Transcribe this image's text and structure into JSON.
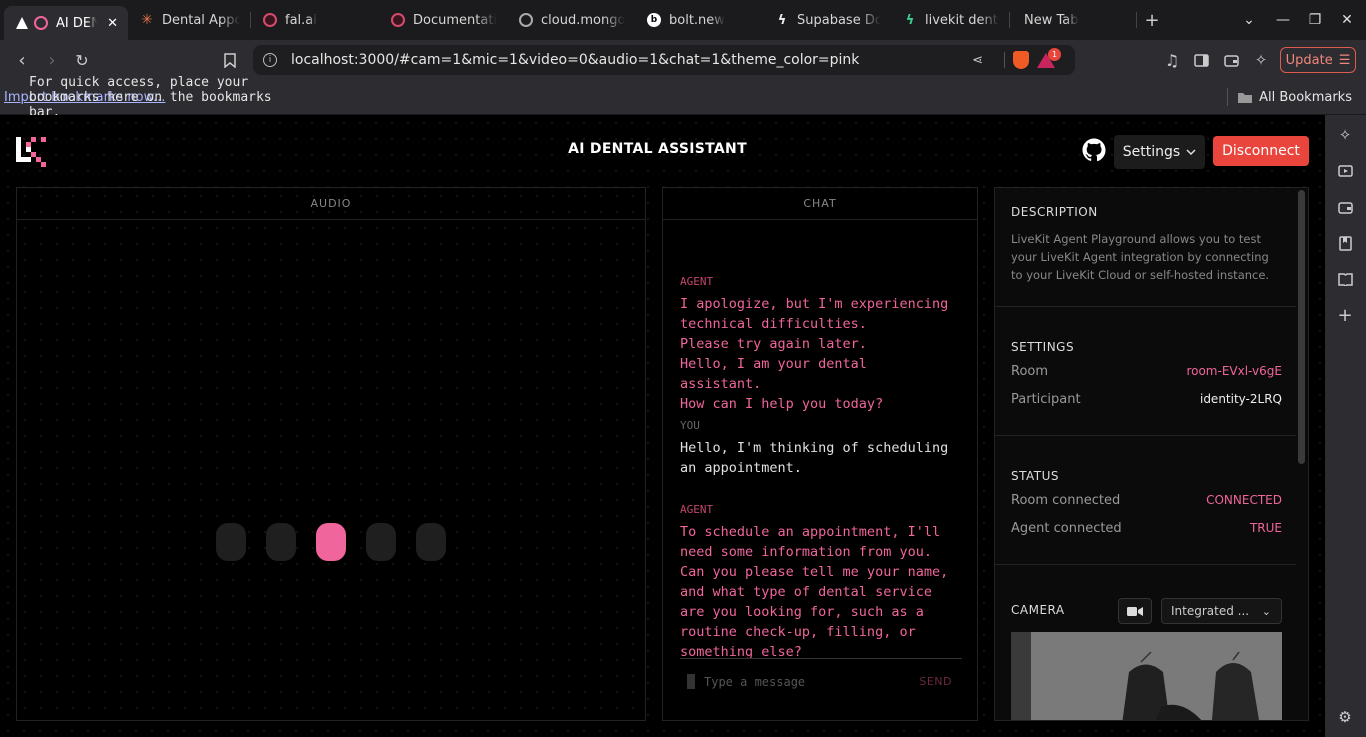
{
  "browser": {
    "tabs": [
      {
        "title": "AI DEN",
        "active": true
      },
      {
        "title": "Dental Appoi"
      },
      {
        "title": "fal.ai"
      },
      {
        "title": "Documentati"
      },
      {
        "title": "cloud.mongo"
      },
      {
        "title": "bolt.new"
      },
      {
        "title": "Supabase Do"
      },
      {
        "title": "livekit dental"
      },
      {
        "title": "New Tab"
      }
    ],
    "url": "localhost:3000/#cam=1&mic=1&video=0&audio=1&chat=1&theme_color=pink",
    "update_label": "Update",
    "notification_count": "1",
    "bookmarks_msg": "For quick access, place your bookmarks here on the bookmarks bar.",
    "bookmarks_link": "Import bookmarks now...",
    "all_bookmarks": "All Bookmarks"
  },
  "app": {
    "title": "AI DENTAL ASSISTANT",
    "settings_label": "Settings",
    "disconnect_label": "Disconnect",
    "accent": "#f0659b"
  },
  "audio": {
    "header": "AUDIO",
    "active_bar_index": 2
  },
  "chat": {
    "header": "CHAT",
    "messages": [
      {
        "who": "AGENT",
        "lines": [
          "I apologize, but I'm experiencing technical difficulties.",
          "Please try again later.",
          "Hello, I am your dental assistant.",
          "How can I help you today?"
        ]
      },
      {
        "who": "YOU",
        "lines": [
          "Hello, I'm thinking of scheduling an appointment."
        ]
      },
      {
        "who": "AGENT",
        "lines": [
          "To schedule an appointment, I'll need some information from you.",
          "Can you please tell me your name, and what type of dental service are you looking for, such as a routine check-up, filling, or something else?"
        ]
      }
    ],
    "placeholder": "Type a message",
    "send_label": "SEND"
  },
  "settings_panel": {
    "description_head": "DESCRIPTION",
    "description": "LiveKit Agent Playground allows you to test your LiveKit Agent integration by connecting to your LiveKit Cloud or self-hosted instance.",
    "settings_head": "SETTINGS",
    "room_label": "Room",
    "room_value": "room-EVxl-v6gE",
    "participant_label": "Participant",
    "participant_value": "identity-2LRQ",
    "status_head": "STATUS",
    "room_connected_label": "Room connected",
    "room_connected_value": "CONNECTED",
    "agent_connected_label": "Agent connected",
    "agent_connected_value": "TRUE",
    "camera_head": "CAMERA",
    "camera_device": "Integrated ..."
  }
}
